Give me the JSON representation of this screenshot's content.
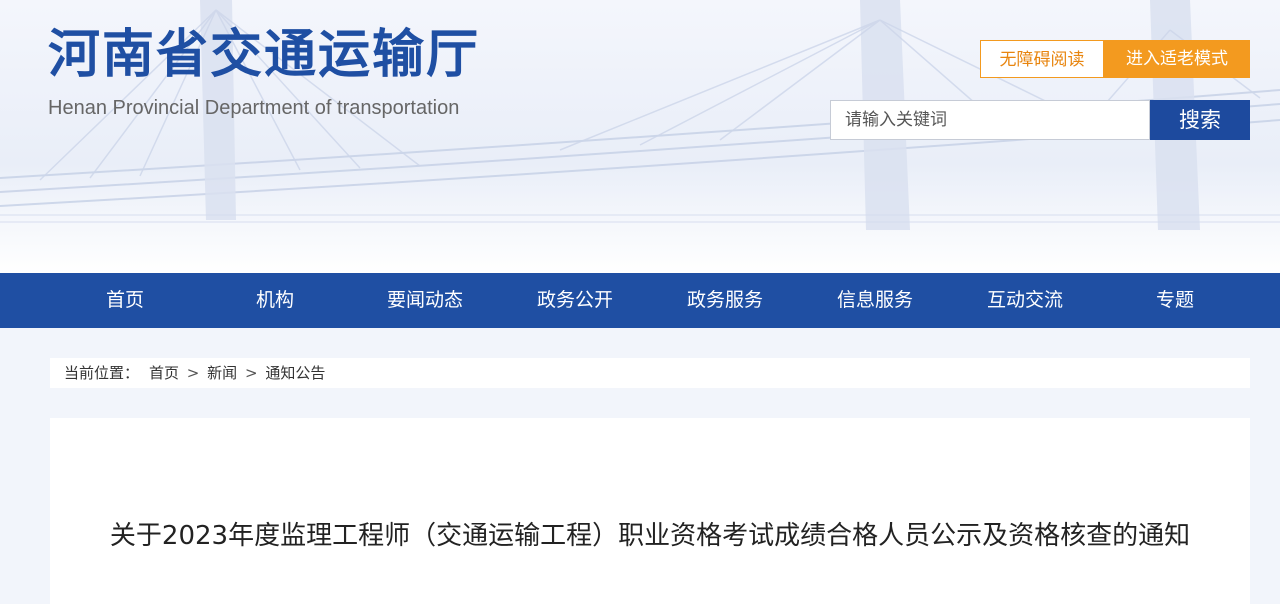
{
  "header": {
    "title": "河南省交通运输厅",
    "subtitle": "Henan Provincial Department of transportation",
    "accessibility_label": "无障碍阅读",
    "elder_mode_label": "进入适老模式",
    "search": {
      "placeholder": "请输入关键词",
      "button_label": "搜索"
    },
    "colors": {
      "brand_blue": "#1f4fa3",
      "accent_orange": "#f39a1f"
    }
  },
  "nav": {
    "items": [
      {
        "label": "首页"
      },
      {
        "label": "机构"
      },
      {
        "label": "要闻动态"
      },
      {
        "label": "政务公开"
      },
      {
        "label": "政务服务"
      },
      {
        "label": "信息服务"
      },
      {
        "label": "互动交流"
      },
      {
        "label": "专题"
      }
    ]
  },
  "breadcrumb": {
    "prefix": "当前位置：",
    "items": [
      {
        "label": "首页"
      },
      {
        "label": "新闻"
      },
      {
        "label": "通知公告"
      }
    ],
    "separator": ">"
  },
  "article": {
    "title": "关于2023年度监理工程师（交通运输工程）职业资格考试成绩合格人员公示及资格核查的通知"
  }
}
